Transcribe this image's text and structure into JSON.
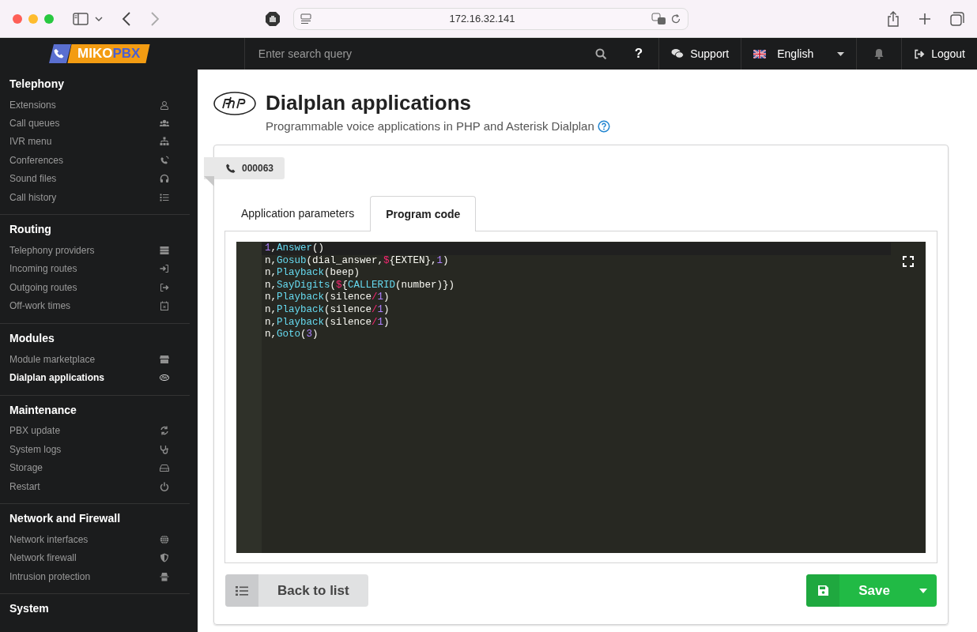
{
  "browser": {
    "url": "172.16.32.141"
  },
  "logo": {
    "part_1": "MIKO",
    "part_2": "PBX"
  },
  "topbar": {
    "search_placeholder": "Enter search query",
    "help": "?",
    "support": "Support",
    "language": "English",
    "logout": "Logout"
  },
  "sidebar": {
    "sections": [
      {
        "title": "Telephony",
        "items": [
          {
            "label": "Extensions",
            "selected": false
          },
          {
            "label": "Call queues",
            "selected": false
          },
          {
            "label": "IVR menu",
            "selected": false
          },
          {
            "label": "Conferences",
            "selected": false
          },
          {
            "label": "Sound files",
            "selected": false
          },
          {
            "label": "Call history",
            "selected": false
          }
        ]
      },
      {
        "title": "Routing",
        "items": [
          {
            "label": "Telephony providers",
            "selected": false
          },
          {
            "label": "Incoming routes",
            "selected": false
          },
          {
            "label": "Outgoing routes",
            "selected": false
          },
          {
            "label": "Off-work times",
            "selected": false
          }
        ]
      },
      {
        "title": "Modules",
        "items": [
          {
            "label": "Module marketplace",
            "selected": false
          },
          {
            "label": "Dialplan applications",
            "selected": true
          }
        ]
      },
      {
        "title": "Maintenance",
        "items": [
          {
            "label": "PBX update",
            "selected": false
          },
          {
            "label": "System logs",
            "selected": false
          },
          {
            "label": "Storage",
            "selected": false
          },
          {
            "label": "Restart",
            "selected": false
          }
        ]
      },
      {
        "title": "Network and Firewall",
        "items": [
          {
            "label": "Network interfaces",
            "selected": false
          },
          {
            "label": "Network firewall",
            "selected": false
          },
          {
            "label": "Intrusion protection",
            "selected": false
          }
        ]
      },
      {
        "title": "System"
      }
    ]
  },
  "header": {
    "title": "Dialplan applications",
    "subtitle": "Programmable voice applications in PHP and Asterisk Dialplan"
  },
  "ribbon": {
    "label": "000063"
  },
  "tabs": [
    {
      "label": "Application parameters",
      "selected": false
    },
    {
      "label": "Program code",
      "selected": true
    }
  ],
  "code": {
    "lines": [
      [
        {
          "kind": "number",
          "text": "1"
        },
        {
          "kind": "plain",
          "text": ","
        },
        {
          "kind": "func",
          "text": "Answer"
        },
        {
          "kind": "plain",
          "text": "()"
        }
      ],
      [
        {
          "kind": "plain",
          "text": "n,"
        },
        {
          "kind": "func",
          "text": "Gosub"
        },
        {
          "kind": "plain",
          "text": "(dial_answer,"
        },
        {
          "kind": "symbol",
          "text": "$"
        },
        {
          "kind": "plain",
          "text": "{EXTEN},"
        },
        {
          "kind": "number",
          "text": "1"
        },
        {
          "kind": "plain",
          "text": ")"
        }
      ],
      [
        {
          "kind": "plain",
          "text": "n,"
        },
        {
          "kind": "func",
          "text": "Playback"
        },
        {
          "kind": "plain",
          "text": "(beep)"
        }
      ],
      [
        {
          "kind": "plain",
          "text": "n,"
        },
        {
          "kind": "func",
          "text": "SayDigits"
        },
        {
          "kind": "plain",
          "text": "("
        },
        {
          "kind": "symbol",
          "text": "$"
        },
        {
          "kind": "plain",
          "text": "{"
        },
        {
          "kind": "func",
          "text": "CALLERID"
        },
        {
          "kind": "plain",
          "text": "(number)})"
        }
      ],
      [
        {
          "kind": "plain",
          "text": "n,"
        },
        {
          "kind": "func",
          "text": "Playback"
        },
        {
          "kind": "plain",
          "text": "(silence"
        },
        {
          "kind": "symbol",
          "text": "/"
        },
        {
          "kind": "number",
          "text": "1"
        },
        {
          "kind": "plain",
          "text": ")"
        }
      ],
      [
        {
          "kind": "plain",
          "text": "n,"
        },
        {
          "kind": "func",
          "text": "Playback"
        },
        {
          "kind": "plain",
          "text": "(silence"
        },
        {
          "kind": "symbol",
          "text": "/"
        },
        {
          "kind": "number",
          "text": "1"
        },
        {
          "kind": "plain",
          "text": ")"
        }
      ],
      [
        {
          "kind": "plain",
          "text": "n,"
        },
        {
          "kind": "func",
          "text": "Playback"
        },
        {
          "kind": "plain",
          "text": "(silence"
        },
        {
          "kind": "symbol",
          "text": "/"
        },
        {
          "kind": "number",
          "text": "1"
        },
        {
          "kind": "plain",
          "text": ")"
        }
      ],
      [
        {
          "kind": "plain",
          "text": "n,"
        },
        {
          "kind": "func",
          "text": "Goto"
        },
        {
          "kind": "plain",
          "text": "("
        },
        {
          "kind": "number",
          "text": "3"
        },
        {
          "kind": "plain",
          "text": ")"
        }
      ]
    ]
  },
  "buttons": {
    "back": "Back to list",
    "save": "Save"
  }
}
